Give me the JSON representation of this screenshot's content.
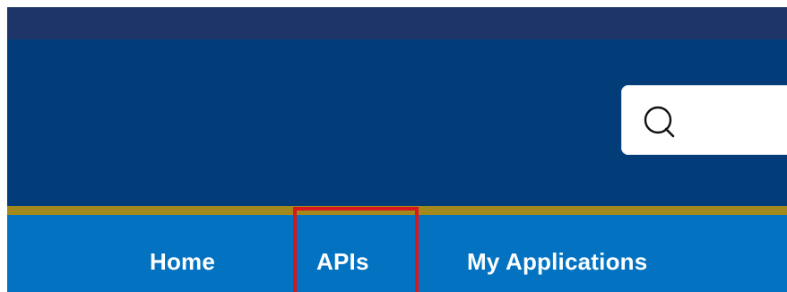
{
  "header": {
    "search": {
      "icon": "search-icon",
      "placeholder": ""
    }
  },
  "nav": {
    "items": [
      {
        "label": "Home",
        "active": false
      },
      {
        "label": "APIs",
        "active": true,
        "highlighted": true
      },
      {
        "label": "My Applications",
        "active": false
      }
    ]
  },
  "colors": {
    "top_strip": "#1d3568",
    "header_bg": "#023d7a",
    "gold_rule": "#a3881c",
    "nav_bg": "#0373c1",
    "highlight": "#d7161e",
    "nav_text": "#ffffff"
  }
}
